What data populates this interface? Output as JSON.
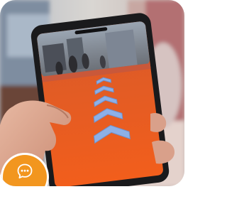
{
  "scene": {
    "chat_button_icon": "chat-bubble-icon",
    "colors": {
      "accent_orange": "#f2961f",
      "ar_arrow": "#8db0e8",
      "floor_orange": "#ec5a20"
    }
  }
}
